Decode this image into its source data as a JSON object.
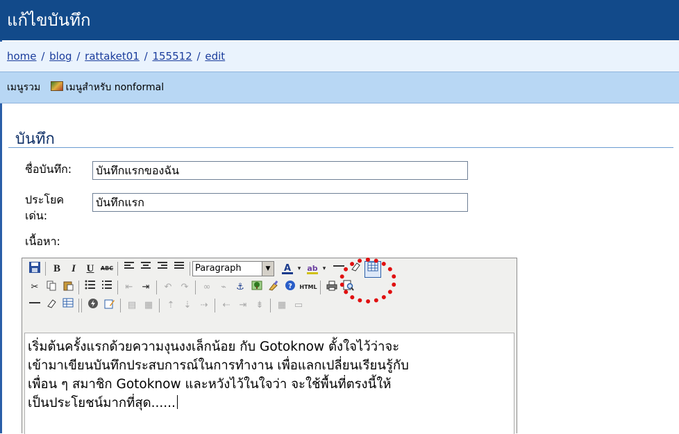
{
  "page": {
    "title": "แก้ไขบันทึก"
  },
  "breadcrumb": {
    "items": [
      "home",
      "blog",
      "rattaket01",
      "155512",
      "edit"
    ],
    "separator": "/"
  },
  "menu": {
    "items": [
      "เมนูรวม",
      "เมนูสำหรับ nonformal"
    ]
  },
  "section": {
    "title": "บันทึก"
  },
  "form": {
    "title_label": "ชื่อบันทึก:",
    "title_value": "บันทึกแรกของฉัน",
    "tagline_label_1": "ประโยค",
    "tagline_label_2": "เด่น:",
    "tagline_value": "บันทึกแรก",
    "content_label": "เนื้อหา:"
  },
  "editor": {
    "format_value": "Paragraph",
    "content_lines": [
      "เริ่มต้นครั้งแรกด้วยความงุนงงเล็กน้อย กับ Gotoknow ตั้งใจไว้ว่าจะ",
      "เข้ามาเขียนบันทึกประสบการณ์ในการทำงาน เพื่อแลกเปลี่ยนเรียนรู้กับ",
      "เพื่อน ๆ สมาชิก Gotoknow และหวังไว้ในใจว่า จะใช้พื้นที่ตรงนี้ให้",
      "เป็นประโยชน์มากที่สุด......"
    ],
    "toolbar_icons": {
      "row1": [
        "save-icon",
        "bold-icon",
        "italic-icon",
        "underline-icon",
        "strikethrough-icon",
        "align-left-icon",
        "align-center-icon",
        "align-right-icon",
        "align-justify-icon",
        "font-color-icon",
        "highlight-color-icon",
        "horizontal-rule-icon",
        "eraser-icon",
        "table-icon"
      ],
      "row2": [
        "cut-icon",
        "copy-icon",
        "paste-icon",
        "bullet-list-icon",
        "numbered-list-icon",
        "outdent-icon",
        "indent-icon",
        "undo-icon",
        "redo-icon",
        "link-icon",
        "unlink-icon",
        "anchor-icon",
        "image-icon",
        "cleanup-icon",
        "help-icon",
        "html-icon",
        "print-icon",
        "preview-icon"
      ],
      "row3": [
        "horizontal-rule-icon",
        "eraser-icon",
        "table-icon",
        "flash-icon",
        "edit-icon",
        "table-row-props-icon",
        "table-cell-props-icon",
        "insert-row-before-icon",
        "insert-row-after-icon",
        "delete-row-icon",
        "insert-col-before-icon",
        "insert-col-after-icon",
        "delete-col-icon",
        "split-cells-icon",
        "merge-cells-icon"
      ]
    },
    "labels": {
      "bold": "B",
      "italic": "I",
      "underline": "U",
      "strike": "ABC",
      "html": "HTML"
    }
  },
  "colors": {
    "title_bar": "#124a8a",
    "menu_bar": "#b8d7f4",
    "highlight_circle": "#e01010"
  }
}
